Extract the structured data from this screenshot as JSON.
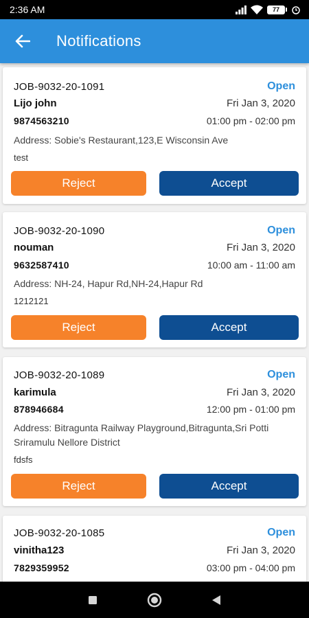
{
  "status_bar": {
    "time": "2:36 AM",
    "battery": "77"
  },
  "app_bar": {
    "title": "Notifications"
  },
  "notifications": [
    {
      "job_id": "JOB-9032-20-1091",
      "status": "Open",
      "name": "Lijo john",
      "date": "Fri Jan 3, 2020",
      "phone": "9874563210",
      "time": "01:00 pm - 02:00 pm",
      "address": "Address: Sobie's Restaurant,123,E Wisconsin Ave",
      "note": "test",
      "reject_label": "Reject",
      "accept_label": "Accept"
    },
    {
      "job_id": "JOB-9032-20-1090",
      "status": "Open",
      "name": "nouman",
      "date": "Fri Jan 3, 2020",
      "phone": "9632587410",
      "time": "10:00 am - 11:00 am",
      "address": "Address: NH-24, Hapur Rd,NH-24,Hapur Rd",
      "note": "1212121",
      "reject_label": "Reject",
      "accept_label": "Accept"
    },
    {
      "job_id": "JOB-9032-20-1089",
      "status": "Open",
      "name": "karimula",
      "date": "Fri Jan 3, 2020",
      "phone": "878946684",
      "time": "12:00 pm - 01:00 pm",
      "address": "Address: Bitragunta Railway Playground,Bitragunta,Sri Potti Sriramulu Nellore District",
      "note": "fdsfs",
      "reject_label": "Reject",
      "accept_label": "Accept"
    },
    {
      "job_id": "JOB-9032-20-1085",
      "status": "Open",
      "name": "vinitha123",
      "date": "Fri Jan 3, 2020",
      "phone": "7829359952",
      "time": "03:00 pm - 04:00 pm"
    }
  ],
  "colors": {
    "app_bar": "#2d8fdc",
    "status_open": "#2d8fdc",
    "reject": "#f6822a",
    "accept": "#0e4e92"
  },
  "icons": {
    "back": "arrow-left-icon",
    "wifi": "wifi-icon",
    "signal": "signal-icon",
    "recents": "square-icon",
    "home": "circle-icon",
    "nav_back": "triangle-back-icon"
  }
}
